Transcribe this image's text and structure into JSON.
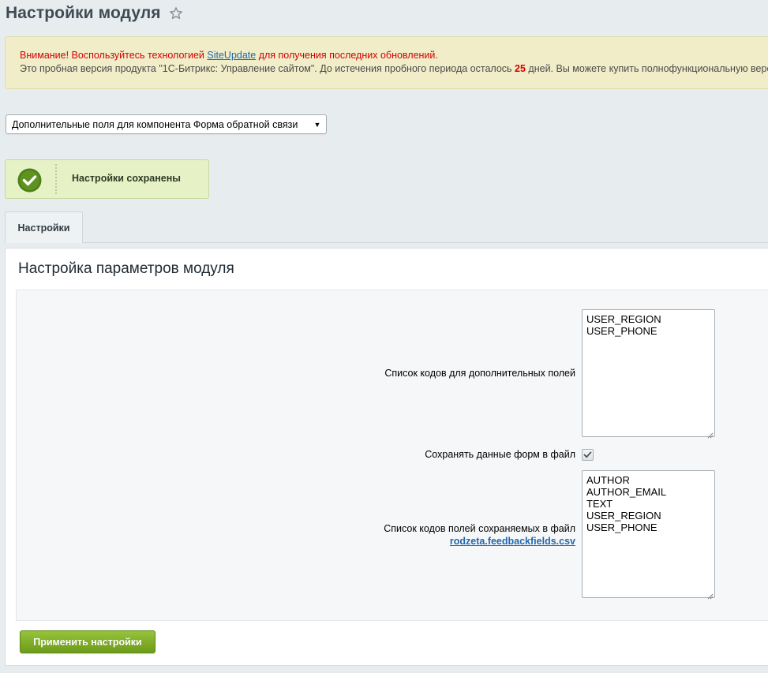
{
  "page": {
    "title": "Настройки модуля"
  },
  "notice": {
    "warning_prefix": "Внимание! Воспользуйтесь технологией ",
    "warning_link": "SiteUpdate",
    "warning_suffix": " для получения последних обновлений.",
    "trial_prefix": "Это пробная версия продукта \"1С-Битрикс: Управление сайтом\". До истечения пробного периода осталось ",
    "trial_days": "25",
    "trial_suffix": " дней. Вы можете купить полнофункциональную версию"
  },
  "module_select": {
    "value": "Дополнительные поля для компонента Форма обратной связи"
  },
  "success": {
    "message": "Настройки сохранены"
  },
  "tabs": [
    {
      "label": "Настройки"
    }
  ],
  "panel": {
    "heading": "Настройка параметров модуля",
    "fields": {
      "extra_codes": {
        "label": "Список кодов для дополнительных полей",
        "lines": [
          "USER_REGION",
          "USER_PHONE"
        ]
      },
      "save_to_file": {
        "label": "Сохранять данные форм в файл",
        "checked": true
      },
      "saved_codes": {
        "label": "Список кодов полей сохраняемых в файл",
        "file_link": "rodzeta.feedbackfields.csv",
        "lines": [
          "AUTHOR",
          "AUTHOR_EMAIL",
          "TEXT",
          "USER_REGION",
          "USER_PHONE"
        ]
      }
    },
    "apply_label": "Применить настройки"
  },
  "colors": {
    "warning_text": "#d50000",
    "link": "#2067b0",
    "success_bg": "#e6f1c6",
    "button_green": "#7eab26"
  }
}
